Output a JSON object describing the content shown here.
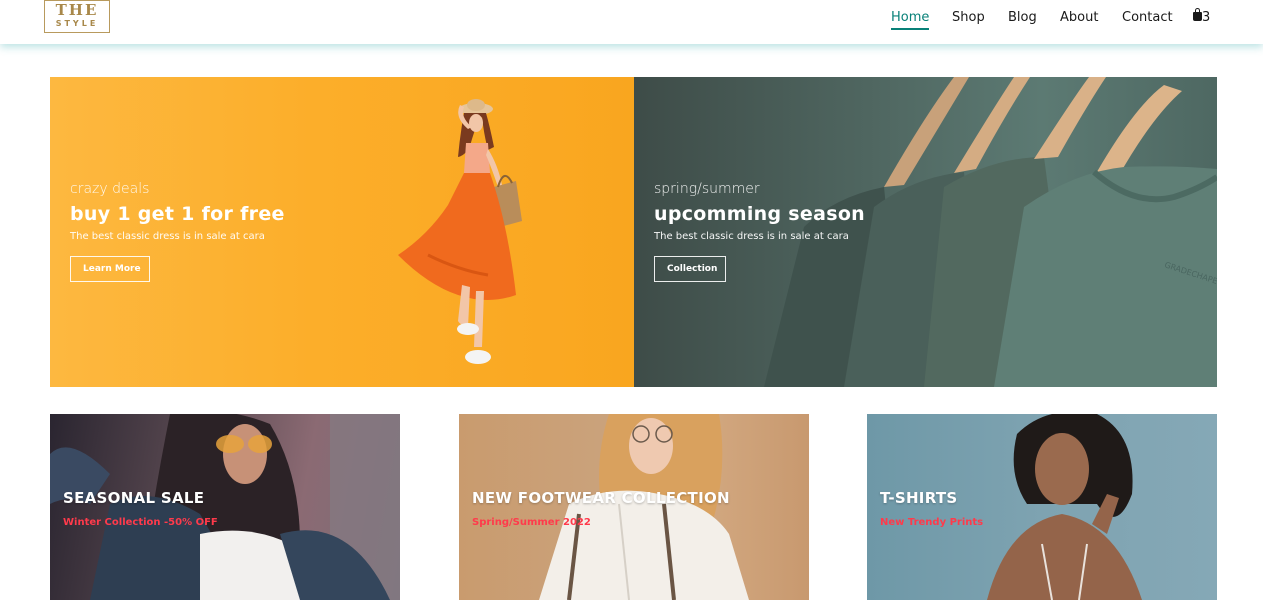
{
  "header": {
    "logo": {
      "line1": "THE",
      "line2": "STYLE"
    },
    "nav": [
      {
        "label": "Home",
        "active": true
      },
      {
        "label": "Shop",
        "active": false
      },
      {
        "label": "Blog",
        "active": false
      },
      {
        "label": "About",
        "active": false
      },
      {
        "label": "Contact",
        "active": false
      }
    ],
    "cart": {
      "icon": "shopping-bag-icon",
      "count": "3"
    },
    "accent_color": "#088178"
  },
  "banners": [
    {
      "eyebrow": "crazy deals",
      "headline": "buy 1 get 1 for free",
      "subtext": "The best classic dress is in sale at cara",
      "button": "Learn More",
      "background_color": "#fcae2a"
    },
    {
      "eyebrow": "spring/summer",
      "headline": "upcomming season",
      "subtext": "The best classic dress is in sale at cara",
      "button": "Collection",
      "background_color": "#4f6660"
    }
  ],
  "tiles": [
    {
      "title": "SEASONAL SALE",
      "subtitle": "Winter Collection -50% OFF",
      "subtitle_color": "#ff3a4b"
    },
    {
      "title": "NEW FOOTWEAR COLLECTION",
      "subtitle": "Spring/Summer 2022",
      "subtitle_color": "#ff3a4b"
    },
    {
      "title": "T-SHIRTS",
      "subtitle": "New Trendy Prints",
      "subtitle_color": "#ff3a4b"
    }
  ]
}
